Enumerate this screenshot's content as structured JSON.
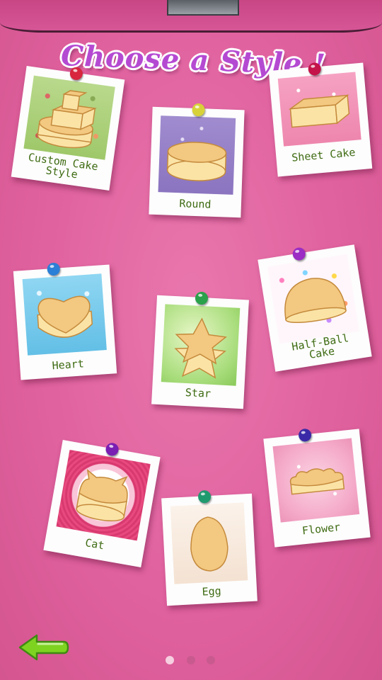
{
  "title": "Choose a Style !",
  "styles": [
    {
      "label_line1": "Custom Cake",
      "label_line2": "Style",
      "pin_color": "#d7263d",
      "photo_bg": "green-polka"
    },
    {
      "label_line1": "Round",
      "pin_color": "#d8d23a",
      "photo_bg": "purple-snowflake"
    },
    {
      "label_line1": "Sheet Cake",
      "pin_color": "#c4144a",
      "photo_bg": "pink-hearts"
    },
    {
      "label_line1": "Heart",
      "pin_color": "#2c7fd6",
      "photo_bg": "blue-snowflake"
    },
    {
      "label_line1": "Star",
      "pin_color": "#2aa14b",
      "photo_bg": "green-bokeh"
    },
    {
      "label_line1": "Half-Ball",
      "label_line2": "Cake",
      "pin_color": "#9b2cc4",
      "photo_bg": "confetti-stars"
    },
    {
      "label_line1": "Cat",
      "pin_color": "#7a1fb3",
      "photo_bg": "pink-lace"
    },
    {
      "label_line1": "Egg",
      "pin_color": "#1f9a6f",
      "photo_bg": "peach"
    },
    {
      "label_line1": "Flower",
      "pin_color": "#3a2aa8",
      "photo_bg": "pink-sparkle"
    }
  ],
  "pagination": {
    "pages": 3,
    "current": 1
  },
  "colors": {
    "background": "#e0629f",
    "title": "#b54ad2",
    "caption": "#3e6b12",
    "back_arrow": "#7ed321"
  },
  "icons": {
    "back": "left-arrow-icon"
  }
}
